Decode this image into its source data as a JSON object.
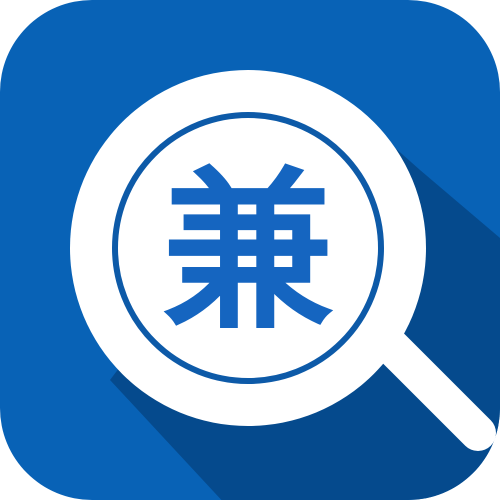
{
  "icon": {
    "name": "magnifier-app-icon",
    "glyph": "兼",
    "colors": {
      "tile": "#0862b6",
      "tile_shadow": "#054a8d",
      "lens_ring": "#ffffff",
      "lens_fill": "#ffffff",
      "inner_ring": "#0d5aa8",
      "glyph": "#1565c0",
      "background": "#ffffff"
    }
  }
}
